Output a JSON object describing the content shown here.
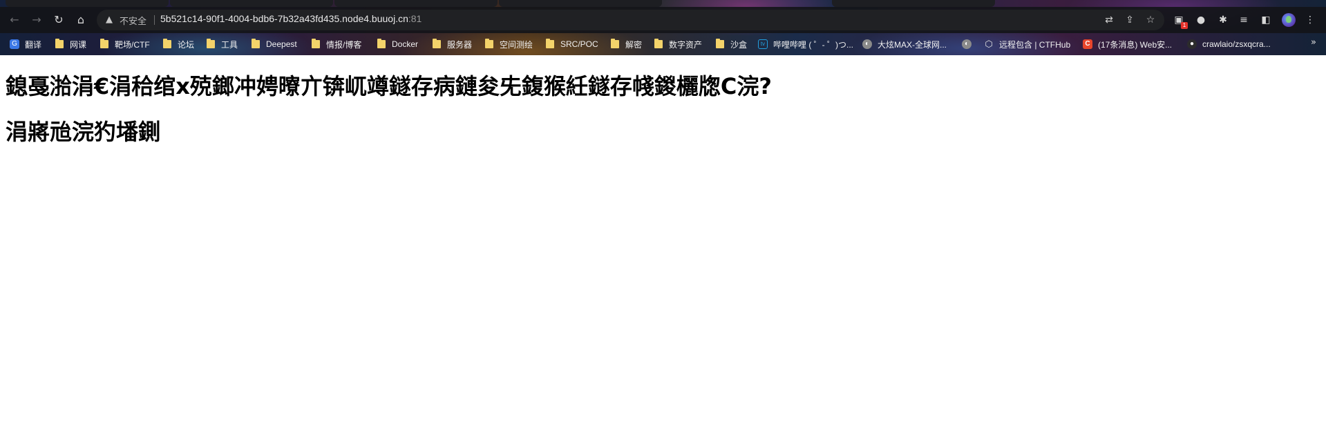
{
  "browser": {
    "security_label": "不安全",
    "url_host": "5b521c14-90f1-4004-bdb6-7b32a43fd435.node4.buuoj.cn",
    "url_port": ":81",
    "extension_badge": "1",
    "icons": {
      "back": "arrow-left",
      "forward": "arrow-right",
      "reload": "reload",
      "home": "home",
      "security": "warning-triangle",
      "translate": "translate",
      "share": "share",
      "bookmark": "star",
      "extension": "extension-puzzle",
      "reading_list": "reading-list",
      "side_panel": "side-panel",
      "menu": "kebab-menu"
    }
  },
  "bookmarks": [
    {
      "label": "翻译",
      "icon": "translate-icon"
    },
    {
      "label": "网课",
      "icon": "folder-icon"
    },
    {
      "label": "靶场/CTF",
      "icon": "folder-icon"
    },
    {
      "label": "论坛",
      "icon": "folder-icon"
    },
    {
      "label": "工具",
      "icon": "folder-icon"
    },
    {
      "label": "Deepest",
      "icon": "folder-icon"
    },
    {
      "label": "情报/博客",
      "icon": "folder-icon"
    },
    {
      "label": "Docker",
      "icon": "folder-icon"
    },
    {
      "label": "服务器",
      "icon": "folder-icon"
    },
    {
      "label": "空间测绘",
      "icon": "folder-icon"
    },
    {
      "label": "SRC/POC",
      "icon": "folder-icon"
    },
    {
      "label": "解密",
      "icon": "folder-icon"
    },
    {
      "label": "数字资产",
      "icon": "folder-icon"
    },
    {
      "label": "沙盒",
      "icon": "folder-icon"
    },
    {
      "label": "哔哩哔哩 ( ゜- ゜)つ...",
      "icon": "bilibili-icon"
    },
    {
      "label": "大炫MAX-全球网...",
      "icon": "globe-icon"
    },
    {
      "label": "",
      "icon": "globe-icon"
    },
    {
      "label": "远程包含 | CTFHub",
      "icon": "ctfhub-icon"
    },
    {
      "label": "(17条消息) Web安...",
      "icon": "csdn-icon"
    },
    {
      "label": "crawlaio/zsxqcra...",
      "icon": "github-icon"
    }
  ],
  "page": {
    "heading1": "鎴戞湁涓€涓秴绾х殑鎯冲娉曢亣锛屼竴鐩存病鏈夋兂鍑猴紝鐩存帴鍐欐牎C浣?",
    "heading2": "涓嶈兘浣犳墦鍘"
  }
}
